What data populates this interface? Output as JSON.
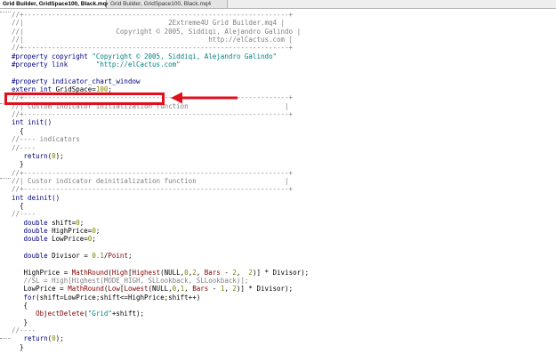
{
  "tabs": [
    {
      "label": "Grid Builder, GridSpace100, Black.mq4"
    },
    {
      "label": "Grid Builder, GridSpace100, Black.mq4"
    }
  ],
  "colors": {
    "highlight_box": "#e0101c",
    "arrow": "#e0101c",
    "comment": "#808080",
    "preprocessor": "#000080",
    "string": "#008080",
    "number": "#808000",
    "function": "#800000"
  },
  "code": {
    "l01": "//+------------------------------------------------------------------+",
    "l02": "//|                                    2Extreme4U Grid Builder.mq4 |",
    "l03": "//|                       Copyright © 2005, Siddiqi, Alejandro Galindo |",
    "l04": "//|                                              http://elCactus.com |",
    "l05": "//+------------------------------------------------------------------+",
    "l06_kw": "#property copyright",
    "l06_str": "\"Copyright © 2005, Siddiqi, Alejandro Galindo\"",
    "l07_kw": "#property link",
    "l07_str": "\"http://elCactus.com\"",
    "l08": "",
    "l09": "#property indicator_chart_window",
    "l10_kw": "extern int",
    "l10_txt": " GridSpace=",
    "l10_num": "100",
    "l10_end": ";",
    "l11": "//+------------------------------------------------------------------+",
    "l12": "//| Custom indicator initialization function                        |",
    "l13": "//+------------------------------------------------------------------+",
    "l14": "int init()",
    "l15": "  {",
    "l16": "//---- indicators",
    "l17": "//----",
    "l18_kw": "   return",
    "l18_txt": "(",
    "l18_num": "0",
    "l18_end": ");",
    "l19": "  }",
    "l20": "//+------------------------------------------------------------------+",
    "l21": "//| Custor indicator deinitialization function                      |",
    "l22": "//+------------------------------------------------------------------+",
    "l23": "int deinit()",
    "l24": "  {",
    "l25": "//----",
    "l26_kw": "   double",
    "l26_txt": " shift=",
    "l26_num": "0",
    "l26_end": ";",
    "l27_kw": "   double",
    "l27_txt": " HighPrice=",
    "l27_num": "0",
    "l27_end": ";",
    "l28_kw": "   double",
    "l28_txt": " LowPrice=",
    "l28_num": "0",
    "l28_end": ";",
    "l29": "",
    "l30_kw": "   double",
    "l30_txt": " Divisor = ",
    "l30_num": "0.1",
    "l30_mid": "/",
    "l30_fn": "Point",
    "l30_end": ";",
    "l31": "",
    "l32_a": "   HighPrice = ",
    "l32_fn1": "MathRound",
    "l32_b": "(",
    "l32_fn2": "High",
    "l32_c": "[",
    "l32_fn3": "Highest",
    "l32_d": "(NULL,",
    "l32_n1": "0",
    "l32_e": ",",
    "l32_n2": "2",
    "l32_f": ", ",
    "l32_fn4": "Bars",
    "l32_g": " - ",
    "l32_n3": "2",
    "l32_h": ",  ",
    "l32_n4": "2",
    "l32_i": ")] * Divisor);",
    "l33": "   //SL = High[Highest(MODE_HIGH, SLLookback, SLLookback)];",
    "l34_a": "   LowPrice = ",
    "l34_fn1": "MathRound",
    "l34_b": "(",
    "l34_fn2": "Low",
    "l34_c": "[",
    "l34_fn3": "Lowest",
    "l34_d": "(NULL,",
    "l34_n1": "0",
    "l34_e": ",",
    "l34_n2": "1",
    "l34_f": ", ",
    "l34_fn4": "Bars",
    "l34_g": " - ",
    "l34_n3": "1",
    "l34_h": ", ",
    "l34_n4": "2",
    "l34_i": ")] * Divisor);",
    "l35_kw": "   for",
    "l35_txt": "(shift=LowPrice;shift<=HighPrice;shift++)",
    "l36": "   {",
    "l37_fn": "      ObjectDelete",
    "l37_a": "(",
    "l37_str": "\"Grid\"",
    "l37_b": "+shift);",
    "l38": "   }",
    "l39": "//----",
    "l40_kw": "   return",
    "l40_txt": "(",
    "l40_num": "0",
    "l40_end": ");",
    "l41": "  }"
  }
}
